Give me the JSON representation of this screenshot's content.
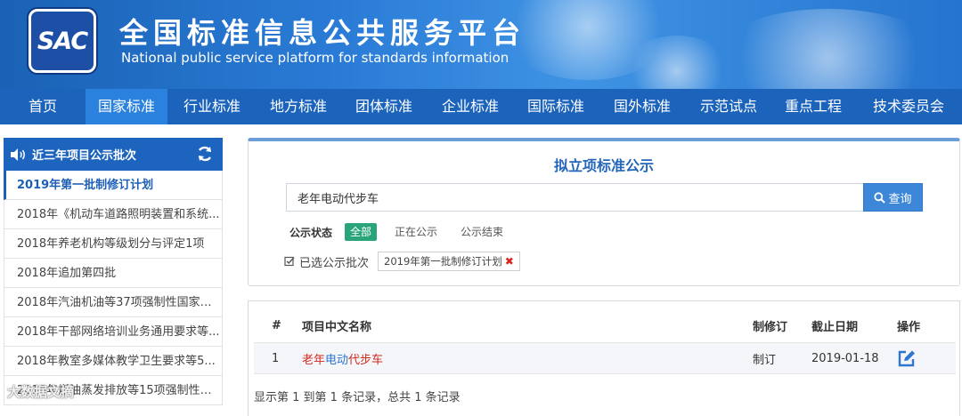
{
  "header": {
    "logo_text": "SAC",
    "title_cn": "全国标准信息公共服务平台",
    "title_en": "National public service platform  for standards information"
  },
  "nav": {
    "items": [
      "首页",
      "国家标准",
      "行业标准",
      "地方标准",
      "团体标准",
      "企业标准",
      "国际标准",
      "国外标准",
      "示范试点",
      "重点工程",
      "技术委员会"
    ],
    "active": "国家标准"
  },
  "sidebar": {
    "title": "近三年项目公示批次",
    "items": [
      "2019年第一批制修订计划",
      "2018年《机动车道路照明装置和系统...",
      "2018年养老机构等级划分与评定1项",
      "2018年追加第四批",
      "2018年汽油机油等37项强制性国家标...",
      "2018年干部网络培训业务通用要求等...",
      "2018年教室多媒体教学卫生要求等5...",
      "2018年燃油蒸发排放等15项强制性国..."
    ]
  },
  "search_panel": {
    "title": "拟立项标准公示",
    "search_value": "老年电动代步车",
    "search_button": "查询",
    "status_label": "公示状态",
    "status_options": [
      "全部",
      "正在公示",
      "公示结束"
    ],
    "status_selected": "全部",
    "batch_label": "已选公示批次",
    "batch_chip": "2019年第一批制修订计划"
  },
  "table": {
    "headers": {
      "num": "#",
      "name": "项目中文名称",
      "revision": "制修订",
      "deadline": "截止日期",
      "action": "操作"
    },
    "rows": [
      {
        "num": "1",
        "name_parts": [
          "老年",
          "电动",
          "代步车"
        ],
        "revision": "制订",
        "deadline": "2019-01-18"
      }
    ]
  },
  "pagination": "显示第 1 到第 1 条记录，总共 1 条记录",
  "watermark": "大数据文摘",
  "colors": {
    "brand_blue": "#1c63bb",
    "nav_active": "#2b82de",
    "status_active": "#2aa57a",
    "link_red": "#d12a1f",
    "link_blue": "#2e76cf"
  }
}
